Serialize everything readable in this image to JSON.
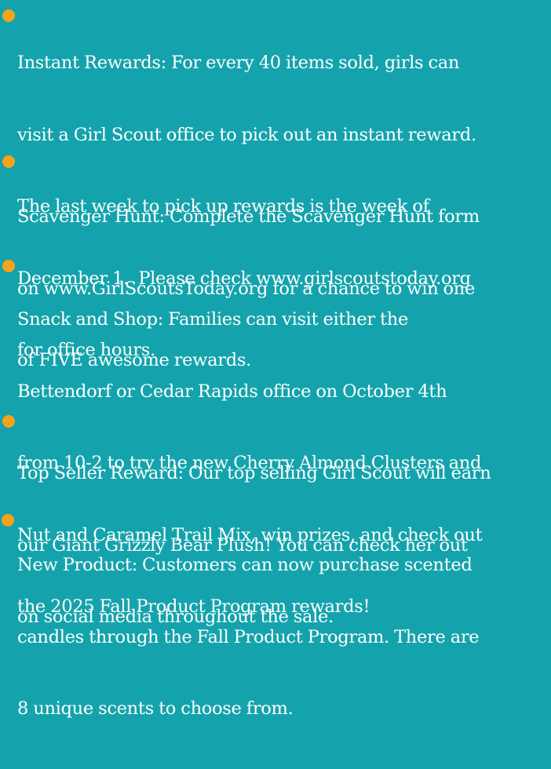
{
  "colors": {
    "background": "#14a3ac",
    "bullet": "#f7a21b",
    "text": "#ffffff"
  },
  "items": [
    {
      "lines": [
        "Instant Rewards: For every 40 items sold, girls can",
        "visit a Girl Scout office to pick out an instant reward.",
        "The last week to pick up rewards is the week of",
        "December 1.  Please check www.girlscoutstoday.org",
        "for office hours."
      ]
    },
    {
      "lines": [
        "Scavenger Hunt: Complete the Scavenger Hunt form",
        "on www.GirlScoutsToday.org for a chance to win one",
        "of FIVE awesome rewards."
      ]
    },
    {
      "lines": [
        "Snack and Shop: Families can visit either the",
        "Bettendorf or Cedar Rapids office on October 4th",
        "from 10-2 to try the new Cherry Almond Clusters and",
        "Nut and Caramel Trail Mix, win prizes, and check out",
        "the 2025 Fall Product Program rewards!"
      ]
    },
    {
      "lines": [
        "Top Seller Reward: Our top selling Girl Scout will earn",
        "our Giant Grizzly Bear Plush! You can check her out",
        "on social media throughout the sale."
      ]
    },
    {
      "lines": [
        "New Product: Customers can now purchase scented",
        "candles through the Fall Product Program. There are",
        "8 unique scents to choose from."
      ]
    }
  ]
}
